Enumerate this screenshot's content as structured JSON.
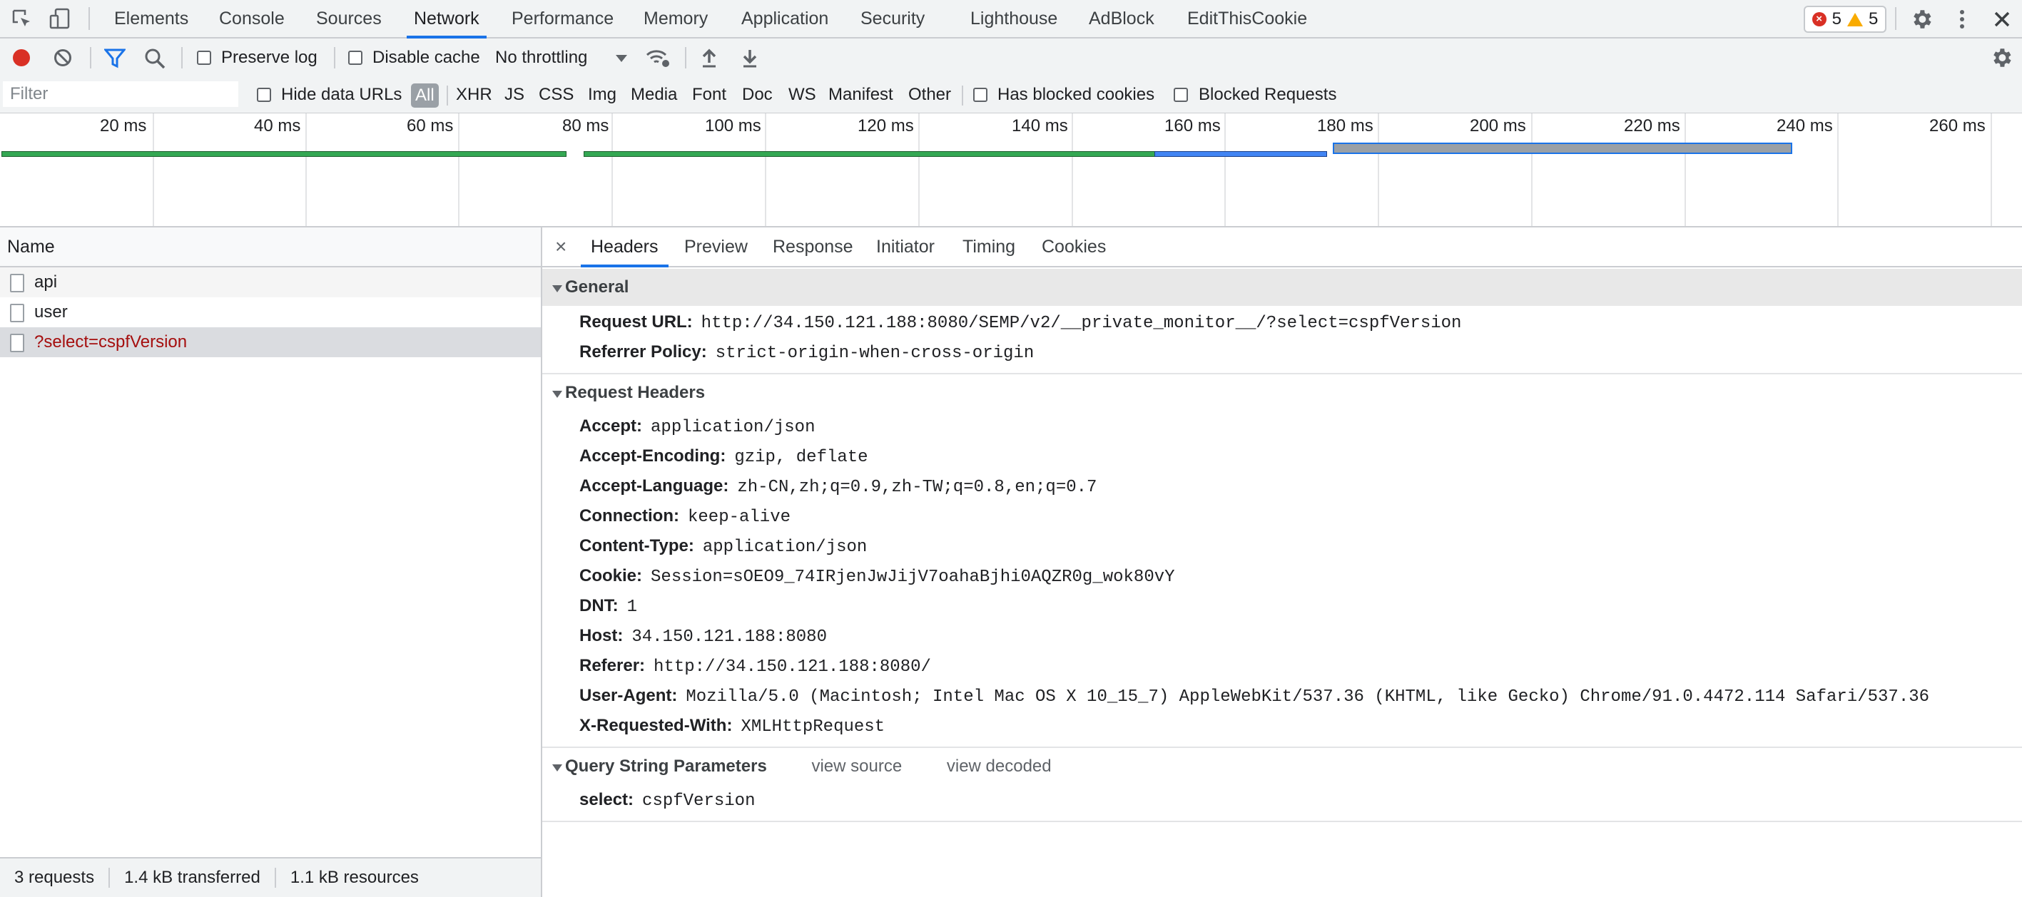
{
  "tabs": [
    "Elements",
    "Console",
    "Sources",
    "Network",
    "Performance",
    "Memory",
    "Application",
    "Security",
    "Lighthouse",
    "AdBlock",
    "EditThisCookie"
  ],
  "active_tab": "Network",
  "counts": {
    "errors": "5",
    "warnings": "5"
  },
  "toolbar": {
    "preserve_log": "Preserve log",
    "disable_cache": "Disable cache",
    "throttling": "No throttling"
  },
  "filterbar": {
    "placeholder": "Filter",
    "hide_data_urls": "Hide data URLs",
    "types": [
      "All",
      "XHR",
      "JS",
      "CSS",
      "Img",
      "Media",
      "Font",
      "Doc",
      "WS",
      "Manifest",
      "Other"
    ],
    "has_blocked_cookies": "Has blocked cookies",
    "blocked_requests": "Blocked Requests"
  },
  "overview": {
    "ticks": [
      "20 ms",
      "40 ms",
      "60 ms",
      "80 ms",
      "100 ms",
      "120 ms",
      "140 ms",
      "160 ms",
      "180 ms",
      "200 ms",
      "220 ms",
      "240 ms",
      "260 ms"
    ]
  },
  "list": {
    "header": "Name",
    "rows": [
      "api",
      "user",
      "?select=cspfVersion"
    ]
  },
  "status": {
    "requests": "3 requests",
    "transferred": "1.4 kB transferred",
    "resources": "1.1 kB resources"
  },
  "details": {
    "close": "×",
    "tabs": [
      "Headers",
      "Preview",
      "Response",
      "Initiator",
      "Timing",
      "Cookies"
    ],
    "general": {
      "title": "General",
      "items": [
        {
          "k": "Request URL:",
          "v": "http://34.150.121.188:8080/SEMP/v2/__private_monitor__/?select=cspfVersion"
        },
        {
          "k": "Referrer Policy:",
          "v": "strict-origin-when-cross-origin"
        }
      ]
    },
    "request_headers": {
      "title": "Request Headers",
      "items": [
        {
          "k": "Accept:",
          "v": "application/json"
        },
        {
          "k": "Accept-Encoding:",
          "v": "gzip, deflate"
        },
        {
          "k": "Accept-Language:",
          "v": "zh-CN,zh;q=0.9,zh-TW;q=0.8,en;q=0.7"
        },
        {
          "k": "Connection:",
          "v": "keep-alive"
        },
        {
          "k": "Content-Type:",
          "v": "application/json"
        },
        {
          "k": "Cookie:",
          "v": "Session=sOEO9_74IRjenJwJijV7oahaBjhi0AQZR0g_wok80vY"
        },
        {
          "k": "DNT:",
          "v": "1"
        },
        {
          "k": "Host:",
          "v": "34.150.121.188:8080"
        },
        {
          "k": "Referer:",
          "v": "http://34.150.121.188:8080/"
        },
        {
          "k": "User-Agent:",
          "v": "Mozilla/5.0 (Macintosh; Intel Mac OS X 10_15_7) AppleWebKit/537.36 (KHTML, like Gecko) Chrome/91.0.4472.114 Safari/537.36"
        },
        {
          "k": "X-Requested-With:",
          "v": "XMLHttpRequest"
        }
      ]
    },
    "query": {
      "title": "Query String Parameters",
      "view_source": "view source",
      "view_decoded": "view decoded",
      "items": [
        {
          "k": "select:",
          "v": "cspfVersion"
        }
      ]
    }
  }
}
